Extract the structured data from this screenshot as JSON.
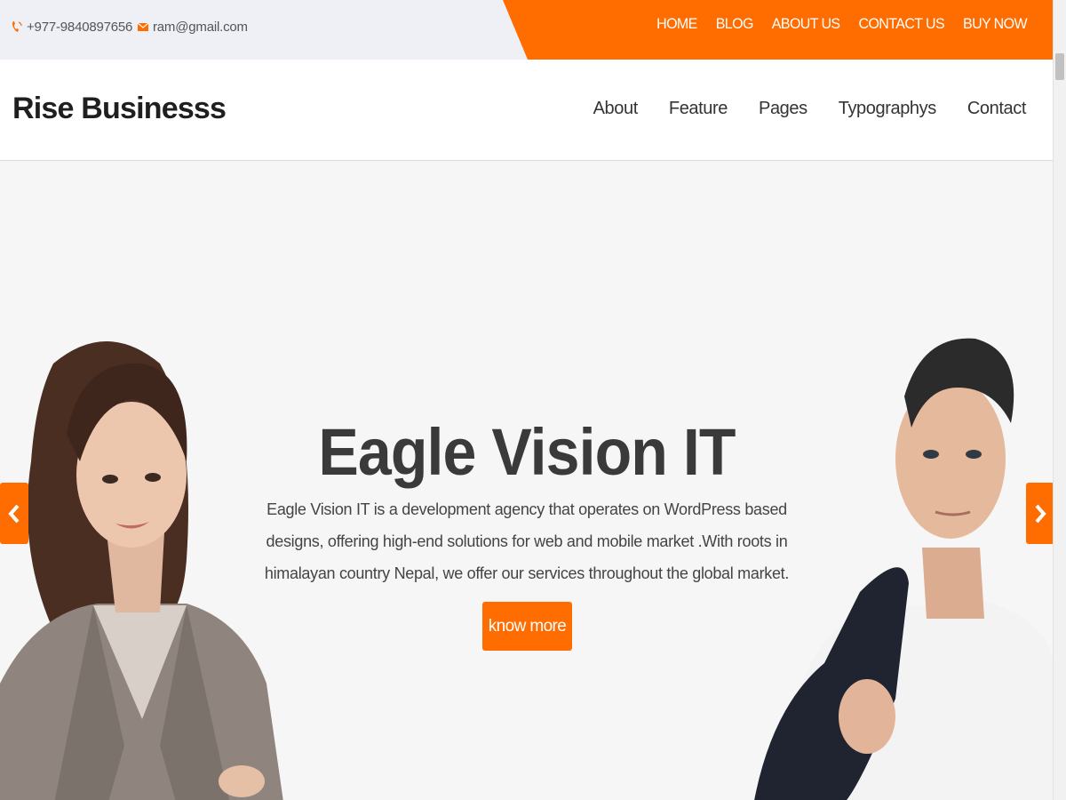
{
  "topbar": {
    "phone": "+977-9840897656",
    "email": "ram@gmail.com",
    "menu": [
      "HOME",
      "BLOG",
      "ABOUT US",
      "CONTACT US",
      "BUY NOW"
    ]
  },
  "header": {
    "logo": "Rise Businesss",
    "menu": [
      "About",
      "Feature",
      "Pages",
      "Typographys",
      "Contact"
    ]
  },
  "hero": {
    "title": "Eagle Vision IT",
    "description": "Eagle Vision IT is a development agency that operates on WordPress based designs, offering high-end solutions for web and mobile market .With roots in himalayan country Nepal, we offer our services throughout the global market.",
    "button": "know more",
    "prev_icon": "chevron-left-icon",
    "next_icon": "chevron-right-icon"
  },
  "colors": {
    "accent": "#ff6c00",
    "topbar_bg": "#eef0f6",
    "hero_bg": "#f6f6f6",
    "text_dark": "#3a3a3a"
  }
}
